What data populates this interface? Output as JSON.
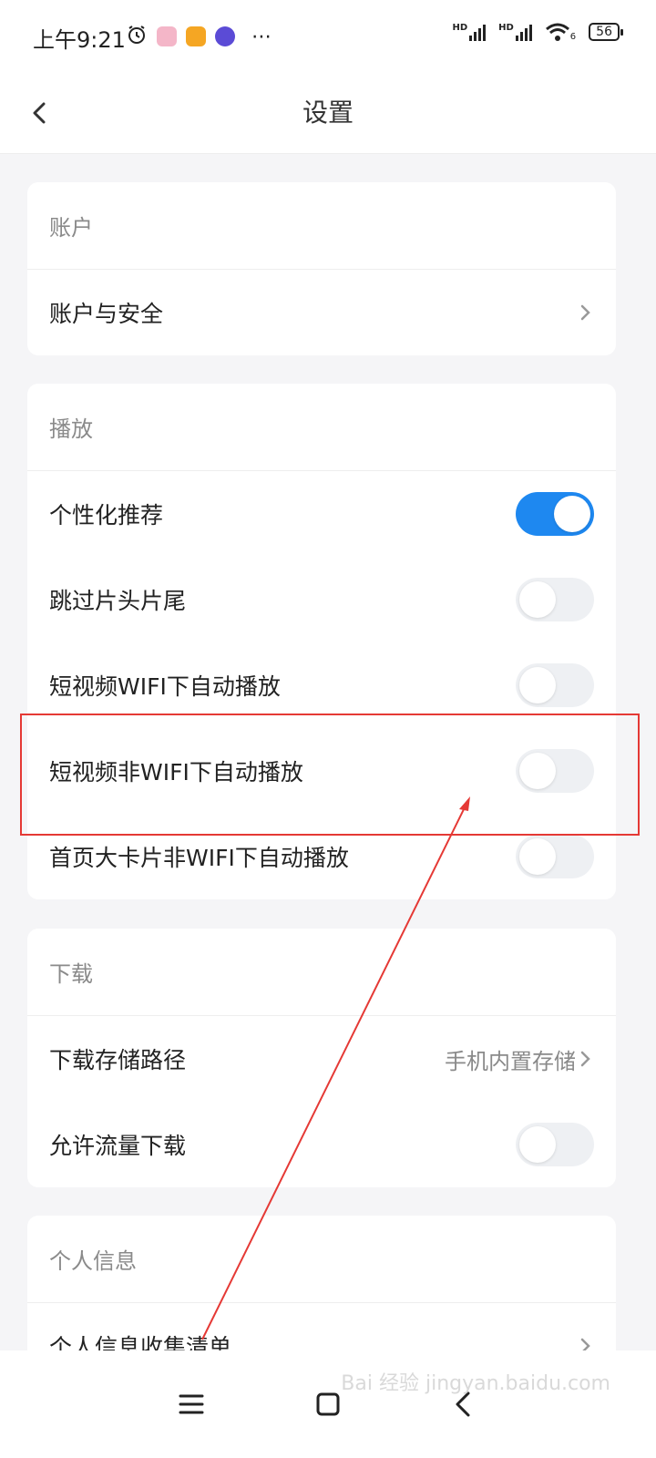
{
  "status": {
    "time": "上午9:21",
    "network_label_1": "HD",
    "network_label_2": "HD",
    "wifi_label": "6",
    "battery": "56"
  },
  "header": {
    "title": "设置"
  },
  "sections": {
    "account": {
      "title": "账户",
      "rows": [
        {
          "label": "账户与安全"
        }
      ]
    },
    "playback": {
      "title": "播放",
      "rows": [
        {
          "label": "个性化推荐",
          "toggle": true
        },
        {
          "label": "跳过片头片尾",
          "toggle": false
        },
        {
          "label": "短视频WIFI下自动播放",
          "toggle": false
        },
        {
          "label": "短视频非WIFI下自动播放",
          "toggle": false
        },
        {
          "label": "首页大卡片非WIFI下自动播放",
          "toggle": false
        }
      ]
    },
    "download": {
      "title": "下载",
      "rows": [
        {
          "label": "下载存储路径",
          "value": "手机内置存储"
        },
        {
          "label": "允许流量下载",
          "toggle": false
        }
      ]
    },
    "personal": {
      "title": "个人信息",
      "rows": [
        {
          "label": "个人信息收集清单"
        }
      ]
    }
  },
  "colors": {
    "accent": "#1e88f0",
    "highlight": "#e53935"
  },
  "watermark": "Bai 经验 jingyan.baidu.com"
}
